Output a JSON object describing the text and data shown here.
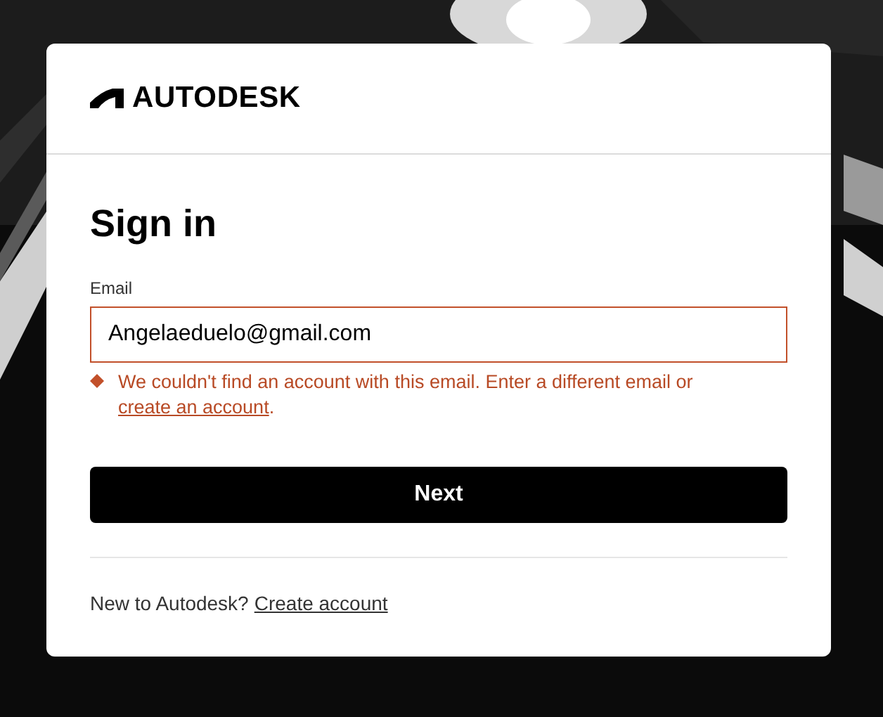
{
  "logo": {
    "text": "AUTODESK"
  },
  "title": "Sign in",
  "email": {
    "label": "Email",
    "value": "Angelaeduelo@gmail.com",
    "invalid": true
  },
  "error": {
    "text": "We couldn't find an account with this email. Enter a different email or ",
    "link": "create an account",
    "after": "."
  },
  "next_button": "Next",
  "footer": {
    "text": "New to Autodesk?",
    "link": "Create account"
  }
}
